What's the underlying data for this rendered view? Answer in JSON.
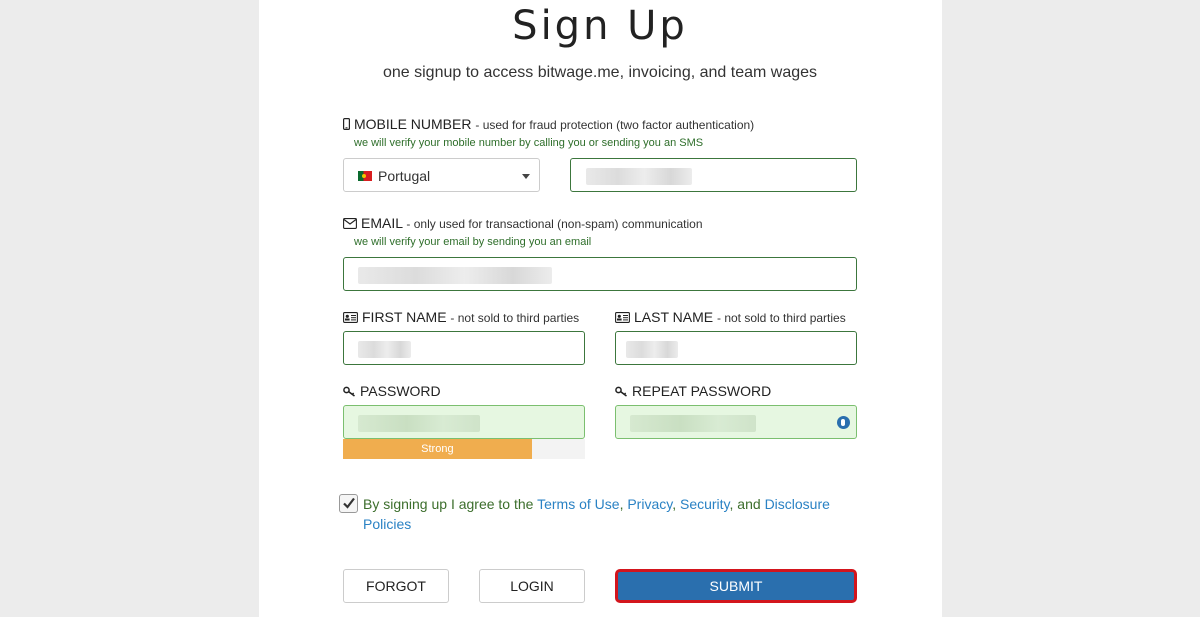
{
  "page": {
    "title": "Sign Up",
    "subtitle": "one signup to access bitwage.me, invoicing, and team wages"
  },
  "mobile": {
    "label": "MOBILE NUMBER",
    "sublabel": "- used for fraud protection (two factor authentication)",
    "hint": "we will verify your mobile number by calling you or sending you an SMS",
    "country": "Portugal",
    "icon": "mobile-phone-icon"
  },
  "email": {
    "label": "EMAIL",
    "sublabel": "- only used for transactional (non-spam) communication",
    "hint": "we will verify your email by sending you an email",
    "icon": "envelope-icon"
  },
  "first_name": {
    "label": "FIRST NAME",
    "sublabel": "- not sold to third parties",
    "icon": "id-card-icon"
  },
  "last_name": {
    "label": "LAST NAME",
    "sublabel": "- not sold to third parties",
    "icon": "id-card-icon"
  },
  "password": {
    "label": "PASSWORD",
    "icon": "key-icon",
    "strength_label": "Strong",
    "strength_fraction": 0.78
  },
  "repeat_password": {
    "label": "REPEAT PASSWORD",
    "icon": "key-icon"
  },
  "agreement": {
    "checked": true,
    "prefix": "By signing up I agree to the",
    "terms": "Terms of Use",
    "comma1": ",",
    "privacy": "Privacy",
    "comma2": ",",
    "security": "Security",
    "and": ", and",
    "disclosure": "Disclosure Policies"
  },
  "buttons": {
    "forgot": "FORGOT",
    "login": "LOGIN",
    "submit": "SUBMIT"
  },
  "colors": {
    "accent": "#2a6fae",
    "hint_green": "#2e6e2a",
    "strength": "#f0ad4e",
    "focus_ring": "#d3151d",
    "link": "#2a82c4"
  }
}
